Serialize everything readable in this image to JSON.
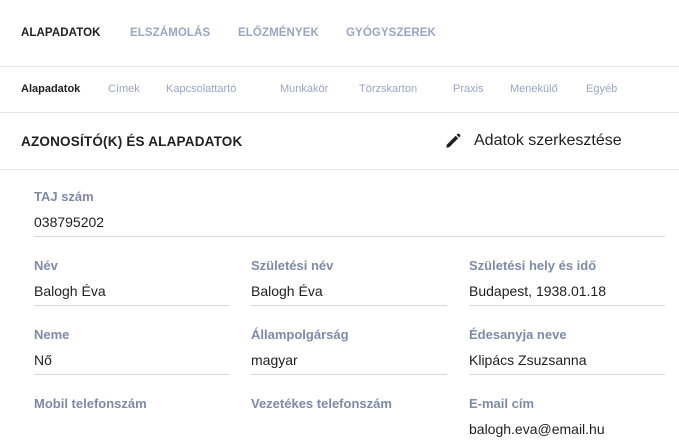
{
  "main_tabs": [
    {
      "label": "ALAPADATOK",
      "active": true
    },
    {
      "label": "ELSZÁMOLÁS",
      "active": false
    },
    {
      "label": "ELŐZMÉNYEK",
      "active": false
    },
    {
      "label": "GYÓGYSZEREK",
      "active": false
    }
  ],
  "sub_tabs": [
    {
      "label": "Alapadatok",
      "active": true
    },
    {
      "label": "Címek",
      "active": false
    },
    {
      "label": "Kapcsolattartó",
      "active": false
    },
    {
      "label": "Munkakör",
      "active": false
    },
    {
      "label": "Törzskarton",
      "active": false
    },
    {
      "label": "Praxis",
      "active": false
    },
    {
      "label": "Menekülő",
      "active": false
    },
    {
      "label": "Egyéb",
      "active": false
    }
  ],
  "section": {
    "title": "AZONOSÍTÓ(K) ÉS ALAPADATOK",
    "edit_label": "Adatok szerkesztése",
    "edit_icon": "pencil-icon"
  },
  "fields": {
    "taj": {
      "label": "TAJ szám",
      "value": "038795202"
    },
    "nev": {
      "label": "Név",
      "value": "Balogh Éva"
    },
    "szuletesi_nev": {
      "label": "Születési név",
      "value": "Balogh Éva"
    },
    "szuletesi_hely_ido": {
      "label": "Születési hely és idő",
      "value": "Budapest, 1938.01.18"
    },
    "neme": {
      "label": "Neme",
      "value": "Nő"
    },
    "allampolgarsag": {
      "label": "Állampolgárság",
      "value": "magyar"
    },
    "edesanyja_neve": {
      "label": "Édesanyja neve",
      "value": "Klipács Zsuzsanna"
    },
    "mobil": {
      "label": "Mobil telefonszám",
      "value": ""
    },
    "vezetekes": {
      "label": "Vezetékes telefonszám",
      "value": ""
    },
    "email": {
      "label": "E-mail cím",
      "value": "balogh.eva@email.hu"
    }
  },
  "colors": {
    "active_text": "#1f1f1f",
    "inactive_tab": "#9aa5c4",
    "field_label": "#7f8aa8",
    "divider": "#e6e6e6"
  }
}
